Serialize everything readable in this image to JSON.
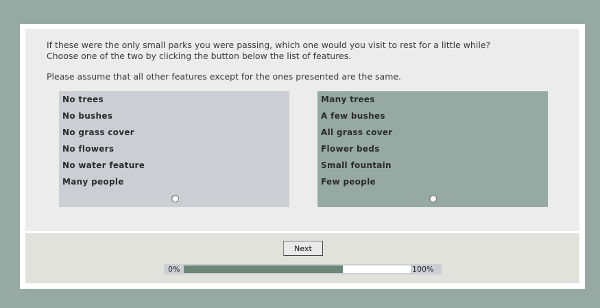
{
  "question": {
    "line1": "If these were the only small parks you were passing, which one would you visit to rest for a little while?",
    "line2": "Choose one of the two by clicking the button below the list of features.",
    "line3": "Please assume that all other features except for the ones presented are the same."
  },
  "options": [
    {
      "features": [
        "No trees",
        "No bushes",
        "No grass cover",
        "No flowers",
        "No water feature",
        "Many people"
      ],
      "selected": false
    },
    {
      "features": [
        "Many trees",
        "A few bushes",
        "All grass cover",
        "Flower beds",
        "Small fountain",
        "Few people"
      ],
      "selected": false
    }
  ],
  "next_label": "Next",
  "progress": {
    "start_label": "0%",
    "end_label": "100%",
    "fraction": 0.7
  },
  "colors": {
    "background": "#96aaa3",
    "option_left": "#cbced3",
    "option_right": "#96aaa3",
    "progress_fill": "#6d8877"
  }
}
